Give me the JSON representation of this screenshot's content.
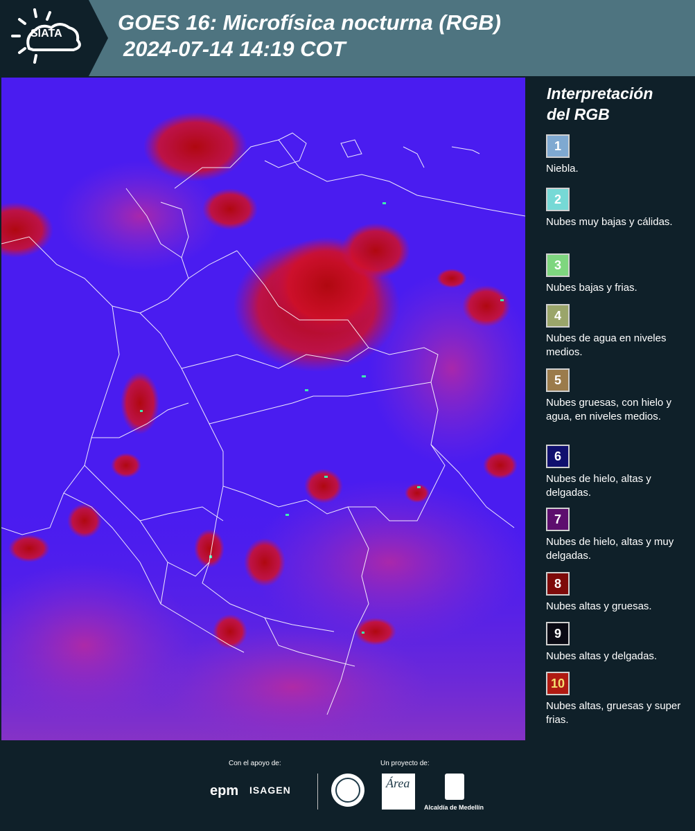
{
  "header": {
    "logo_text": "SIATA",
    "title_line1": "GOES 16: Microfísica nocturna (RGB)",
    "title_line2": "2024-07-14 14:19 COT"
  },
  "legend": {
    "title_line1": "Interpretación",
    "title_line2": "del RGB",
    "items": [
      {
        "number": "1",
        "label": "Niebla.",
        "color": "#7fa9d1"
      },
      {
        "number": "2",
        "label": "Nubes muy bajas y cálidas.",
        "color": "#76d9d6"
      },
      {
        "number": "3",
        "label": "Nubes bajas y frias.",
        "color": "#7ed67f"
      },
      {
        "number": "4",
        "label": "Nubes de agua en niveles medios.",
        "color": "#9aa56a"
      },
      {
        "number": "5",
        "label": "Nubes gruesas, con hielo y agua, en niveles medios.",
        "color": "#9b7b4b"
      },
      {
        "number": "6",
        "label": "Nubes de hielo, altas y delgadas.",
        "color": "#10106e"
      },
      {
        "number": "7",
        "label": "Nubes de hielo, altas y muy delgadas.",
        "color": "#5d0e6e"
      },
      {
        "number": "8",
        "label": "Nubes altas y gruesas.",
        "color": "#7e0a0a"
      },
      {
        "number": "9",
        "label": "Nubes altas y delgadas.",
        "color": "#0a0a14"
      },
      {
        "number": "10",
        "label": "Nubes altas, gruesas y super frias.",
        "color": "#b01a12"
      }
    ]
  },
  "footer": {
    "support_label": "Con el apoyo de:",
    "project_label": "Un proyecto de:",
    "epm_text": "epm",
    "isagen_text": "ISAGEN",
    "alcaldia_text": "Alcaldía de Medellín",
    "area_text": "Área"
  },
  "map": {
    "base_color": "#4a1cf0",
    "cloud_color": "#c4101a",
    "border_color": "#ffffff"
  }
}
